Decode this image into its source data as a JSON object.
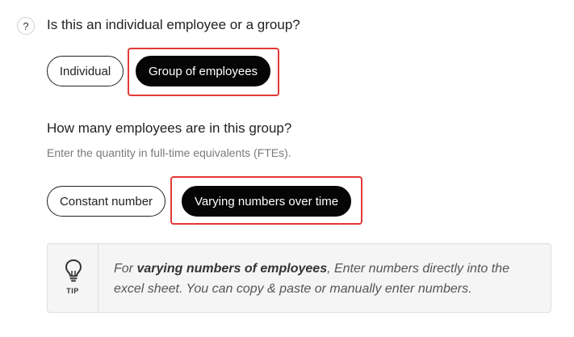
{
  "question1": {
    "help_icon": "question-mark-icon",
    "help_glyph": "?",
    "text": "Is this an individual employee or a group?",
    "options": {
      "individual": "Individual",
      "group": "Group of employees"
    },
    "selected": "Group of employees"
  },
  "question2": {
    "text": "How many employees are in this group?",
    "hint": "Enter the quantity in full-time equivalents (FTEs).",
    "options": {
      "constant": "Constant number",
      "varying": "Varying numbers over time"
    },
    "selected": "Varying numbers over time"
  },
  "tip": {
    "icon": "lightbulb-icon",
    "label": "TIP",
    "prefix": "For ",
    "emphasis": "varying numbers of employees",
    "body": ", Enter numbers directly into the excel sheet. You can copy & paste or manually enter numbers."
  },
  "colors": {
    "highlight": "#e53935",
    "selected_bg": "#050505",
    "tip_bg": "#f5f5f5"
  }
}
